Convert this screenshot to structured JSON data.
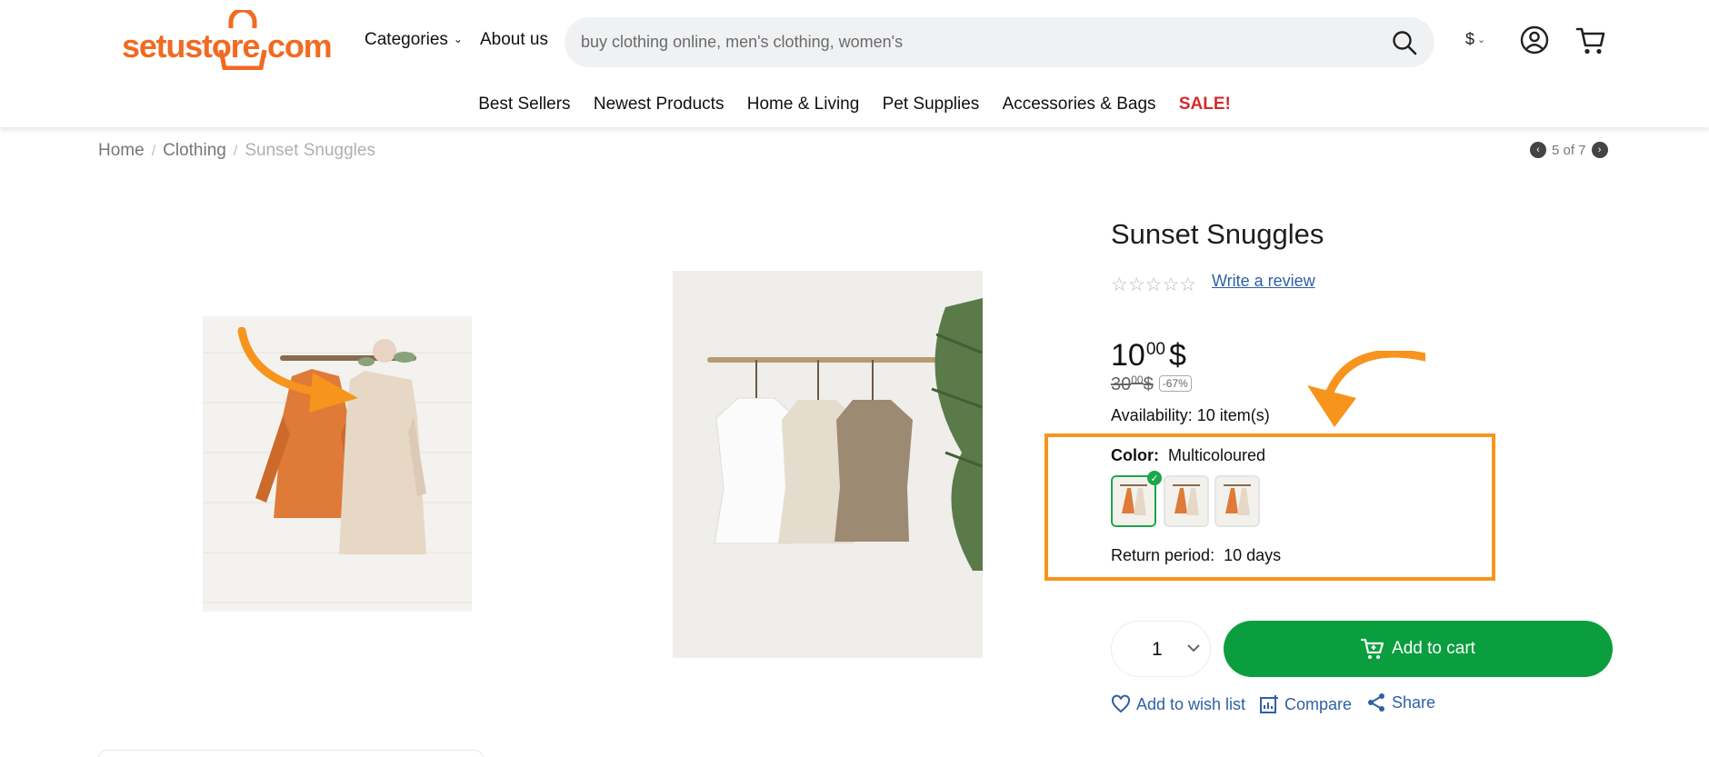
{
  "header": {
    "logo_text": "setustore.com",
    "categories_label": "Categories",
    "about_label": "About us",
    "search_placeholder": "buy clothing online, men's clothing, women's",
    "currency": "$",
    "nav_items": [
      "Best Sellers",
      "Newest Products",
      "Home & Living",
      "Pet Supplies",
      "Accessories & Bags",
      "SALE!"
    ]
  },
  "breadcrumb": {
    "items": [
      "Home",
      "Clothing",
      "Sunset Snuggles"
    ]
  },
  "pager": {
    "text": "5 of 7"
  },
  "product": {
    "title": "Sunset Snuggles",
    "write_review": "Write a review",
    "price": {
      "int": "10",
      "dec": "00",
      "currency": "$"
    },
    "old_price": {
      "int": "30",
      "dec": "00",
      "currency": "$"
    },
    "discount": "-67%",
    "availability": "Availability: 10 item(s)",
    "color_label": "Color:",
    "color_value": "Multicoloured",
    "return_label": "Return period:",
    "return_value": "10 days",
    "quantity": "1",
    "add_to_cart": "Add to cart",
    "wish_list": "Add to wish list",
    "compare": "Compare",
    "share": "Share"
  },
  "colors": {
    "brand": "#f26a21",
    "highlight": "#f7941d",
    "cta_green": "#0a9e3f",
    "link_blue": "#2f5fa7",
    "sale_red": "#d52b2b"
  }
}
